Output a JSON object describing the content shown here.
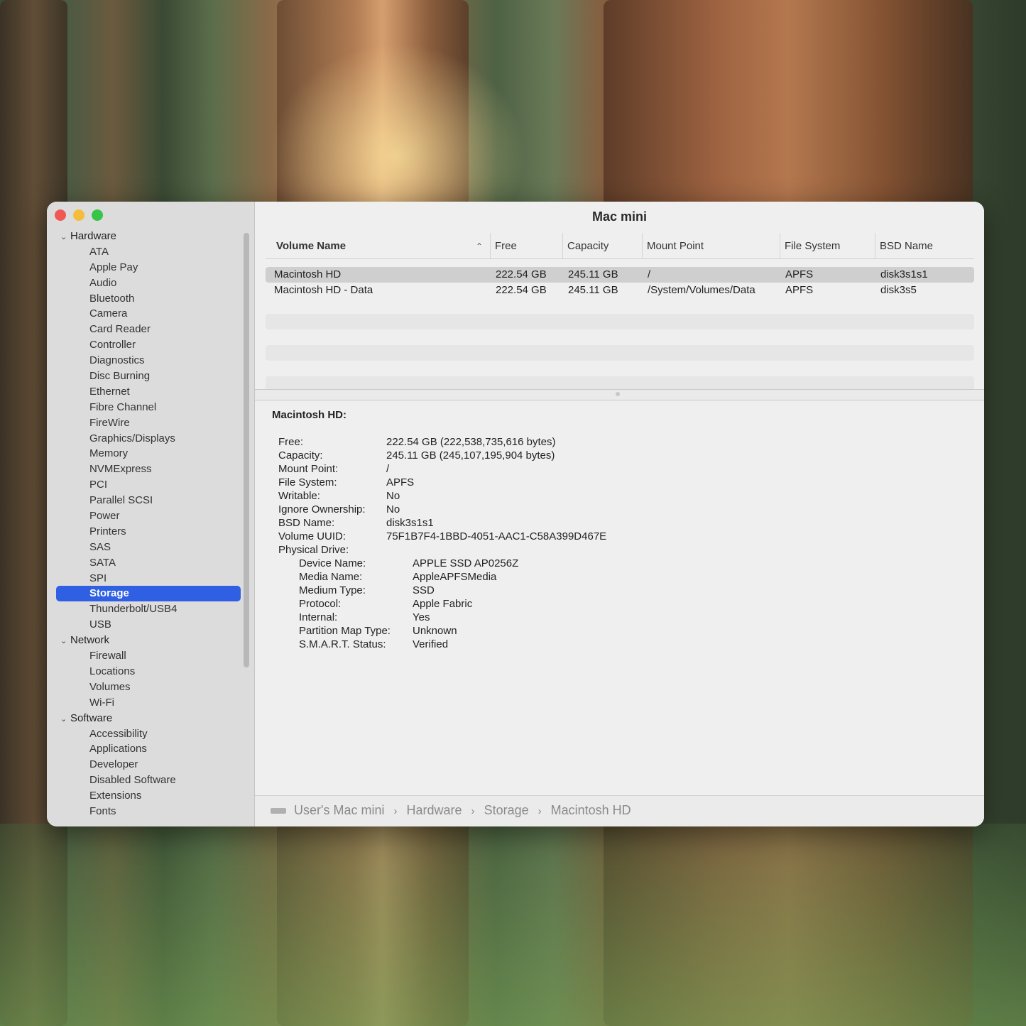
{
  "window": {
    "title": "Mac mini"
  },
  "sidebar": {
    "groups": [
      {
        "label": "Hardware",
        "items": [
          "ATA",
          "Apple Pay",
          "Audio",
          "Bluetooth",
          "Camera",
          "Card Reader",
          "Controller",
          "Diagnostics",
          "Disc Burning",
          "Ethernet",
          "Fibre Channel",
          "FireWire",
          "Graphics/Displays",
          "Memory",
          "NVMExpress",
          "PCI",
          "Parallel SCSI",
          "Power",
          "Printers",
          "SAS",
          "SATA",
          "SPI",
          "Storage",
          "Thunderbolt/USB4",
          "USB"
        ]
      },
      {
        "label": "Network",
        "items": [
          "Firewall",
          "Locations",
          "Volumes",
          "Wi-Fi"
        ]
      },
      {
        "label": "Software",
        "items": [
          "Accessibility",
          "Applications",
          "Developer",
          "Disabled Software",
          "Extensions",
          "Fonts"
        ]
      }
    ],
    "selected": "Storage"
  },
  "table": {
    "columns": [
      "Volume Name",
      "Free",
      "Capacity",
      "Mount Point",
      "File System",
      "BSD Name"
    ],
    "rows": [
      [
        "Macintosh HD",
        "222.54 GB",
        "245.11 GB",
        "/",
        "APFS",
        "disk3s1s1"
      ],
      [
        "Macintosh HD - Data",
        "222.54 GB",
        "245.11 GB",
        "/System/Volumes/Data",
        "APFS",
        "disk3s5"
      ]
    ]
  },
  "detail": {
    "title": "Macintosh HD:",
    "fields": [
      [
        "Free:",
        "222.54 GB (222,538,735,616 bytes)"
      ],
      [
        "Capacity:",
        "245.11 GB (245,107,195,904 bytes)"
      ],
      [
        "Mount Point:",
        "/"
      ],
      [
        "File System:",
        "APFS"
      ],
      [
        "Writable:",
        "No"
      ],
      [
        "Ignore Ownership:",
        "No"
      ],
      [
        "BSD Name:",
        "disk3s1s1"
      ],
      [
        "Volume UUID:",
        "75F1B7F4-1BBD-4051-AAC1-C58A399D467E"
      ],
      [
        "Physical Drive:",
        ""
      ]
    ],
    "physical_drive": [
      [
        "Device Name:",
        "APPLE SSD AP0256Z"
      ],
      [
        "Media Name:",
        "AppleAPFSMedia"
      ],
      [
        "Medium Type:",
        "SSD"
      ],
      [
        "Protocol:",
        "Apple Fabric"
      ],
      [
        "Internal:",
        "Yes"
      ],
      [
        "Partition Map Type:",
        "Unknown"
      ],
      [
        "S.M.A.R.T. Status:",
        "Verified"
      ]
    ]
  },
  "pathbar": [
    "User's Mac mini",
    "Hardware",
    "Storage",
    "Macintosh HD"
  ]
}
